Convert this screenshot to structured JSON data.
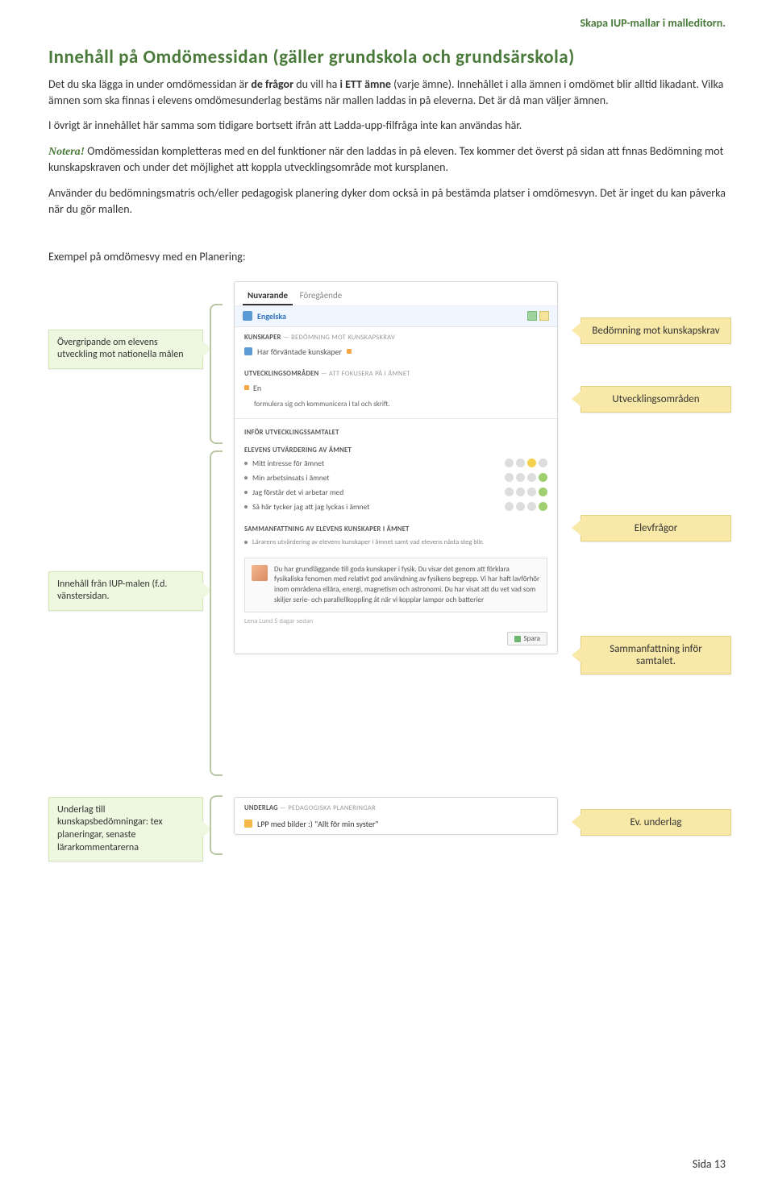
{
  "header": {
    "title_right": "Skapa IUP-mallar i malleditorn."
  },
  "title": "Innehåll på Omdömessidan (gäller grundskola och grundsärskola)",
  "p1a": "Det du ska lägga in under omdömessidan är ",
  "p1b": "de frågor",
  "p1c": " du vill ha ",
  "p1d": "i ETT ämne",
  "p1e": " (varje ämne). Innehållet i alla ämnen i omdömet blir alltid likadant. Vilka ämnen som ska finnas i elevens omdömesunderlag bestäms när mallen laddas in på eleverna. Det är då man väljer ämnen.",
  "p2": "I övrigt är innehållet här samma som tidigare bortsett ifrån att Ladda-upp-filfråga inte kan användas här.",
  "notera": "Notera!",
  "p3": " Omdömessidan kompletteras med en del funktioner när den laddas in på eleven. Tex kommer det överst på sidan att fnnas Bedömning mot kunskapskraven och under det möjlighet att koppla utvecklingsområde mot kursplanen.",
  "p4": "Använder du bedömningsmatris och/eller pedagogisk planering dyker dom också in på bestämda platser i omdömesvyn. Det är inget du kan påverka när du gör mallen.",
  "example_label": "Exempel på omdömesvy med en Planering:",
  "footer": "Sida 13",
  "left_callouts": {
    "a": "Övergripande om elevens utveckling mot nationella målen",
    "b": "Innehåll från IUP-malen (f.d. vänstersidan.",
    "c": "Underlag till kunskapsbedömningar: tex planeringar, senaste lärarkommentarerna"
  },
  "right_callouts": {
    "a": "Bedömning mot kunskapskrav",
    "b": "Utvecklingsområden",
    "c": "Elevfrågor",
    "d": "Sammanfattning inför samtalet.",
    "e": "Ev. underlag"
  },
  "panel": {
    "tab1": "Nuvarande",
    "tab2": "Föregående",
    "subject": "Engelska",
    "kunskaper_lbl": "KUNSKAPER",
    "kunskaper_sub": " — BEDÖMNING MOT KUNSKAPSKRAV",
    "kunskaper_row": "Har förväntade kunskaper",
    "utv_lbl": "UTVECKLINGSOMRÅDEN",
    "utv_sub": " — ATT FOKUSERA PÅ I ÄMNET",
    "utv_row1": "En",
    "utv_row_desc": "formulera sig och kommunicera i tal och skrift.",
    "infor_lbl": "INFÖR UTVECKLINGSSAMTALET",
    "elev_lbl": "ELEVENS UTVÄRDERING AV ÄMNET",
    "q1": "Mitt intresse för ämnet",
    "q2": "Min arbetsinsats i ämnet",
    "q3": "Jag förstår det vi arbetar med",
    "q4": "Så här tycker jag att jag lyckas i ämnet",
    "samman_lbl": "SAMMANFATTNING AV ELEVENS KUNSKAPER I ÄMNET",
    "samman_sub": "Lärarens utvärdering av elevens kunskaper i ämnet samt vad elevens nästa steg blir.",
    "samman_text": "Du har grundläggande till goda kunskaper i fysik. Du visar det genom att förklara fysikaliska fenomen med relativt god användning av fysikens begrepp. Vi har haft lavförhör inom områdena ellära, energi, magnetism och astronomi. Du har visat att du vet vad som skiljer serie- och parallellkoppling åt när vi kopplar lampor och batterier",
    "meta": "Lena Lund 5 dagar sedan",
    "spara": "Spara",
    "underlag_lbl": "UNDERLAG",
    "underlag_sub": " — PEDAGOGISKA PLANERINGAR",
    "lpp": "LPP med bilder :) \"Allt för min syster\""
  }
}
